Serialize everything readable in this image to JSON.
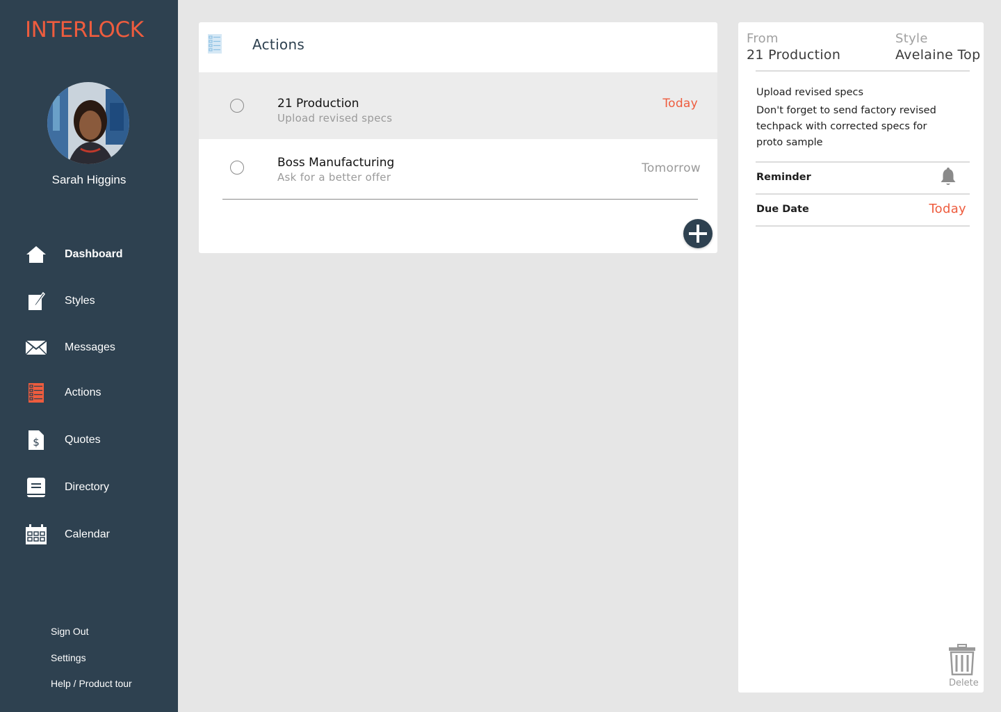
{
  "app": {
    "logo_text": "INTERLOCK",
    "accent_color": "#ee5c3e",
    "sidebar_color": "#2e4150"
  },
  "user": {
    "name": "Sarah Higgins"
  },
  "sidebar": {
    "items": [
      {
        "label": "Dashboard",
        "icon": "home-icon"
      },
      {
        "label": "Styles",
        "icon": "edit-icon"
      },
      {
        "label": "Messages",
        "icon": "envelope-icon"
      },
      {
        "label": "Actions",
        "icon": "checklist-icon"
      },
      {
        "label": "Quotes",
        "icon": "dollar-document-icon"
      },
      {
        "label": "Directory",
        "icon": "book-icon"
      },
      {
        "label": "Calendar",
        "icon": "calendar-icon"
      }
    ],
    "footer": [
      {
        "label": "Sign Out"
      },
      {
        "label": "Settings"
      },
      {
        "label": "Help / Product tour"
      }
    ]
  },
  "actions_panel": {
    "title": "Actions",
    "items": [
      {
        "title": "21 Production",
        "subtitle": "Upload revised specs",
        "due": "Today",
        "due_color": "#ee5c3e"
      },
      {
        "title": "Boss Manufacturing",
        "subtitle": "Ask for a better offer",
        "due": "Tomorrow",
        "due_color": "#9a9a9a"
      }
    ]
  },
  "detail": {
    "from_label": "From",
    "from_value": "21 Production",
    "style_label": "Style",
    "style_value": "Avelaine Top",
    "note_title": "Upload revised specs",
    "note_body": "Don't forget to send factory revised techpack with corrected specs for proto sample",
    "reminder_label": "Reminder",
    "due_date_label": "Due Date",
    "due_date_value": "Today",
    "delete_label": "Delete"
  }
}
